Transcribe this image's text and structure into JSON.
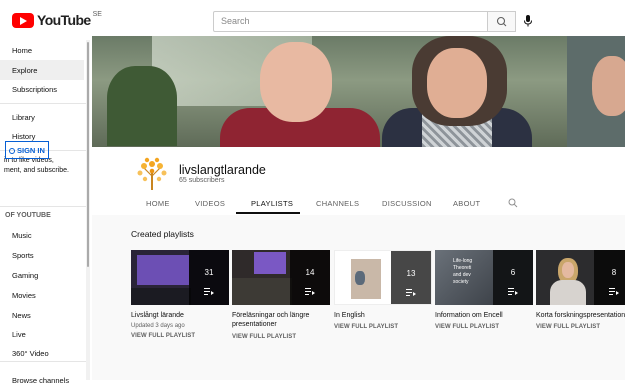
{
  "header": {
    "logo_text": "YouTube",
    "logo_country": "SE",
    "search_placeholder": "Search",
    "brand_color": "#ff0000"
  },
  "sidebar": {
    "items": [
      {
        "label": "Home"
      },
      {
        "label": "Explore",
        "active": true
      },
      {
        "label": "Subscriptions"
      },
      {
        "label": "Library"
      },
      {
        "label": "History"
      }
    ],
    "signin_prompt_line1": "in to like videos,",
    "signin_prompt_line2": "ment, and subscribe.",
    "signin_label": "SIGN IN",
    "section_heading": "OF YOUTUBE",
    "best_of": [
      {
        "label": "Music"
      },
      {
        "label": "Sports"
      },
      {
        "label": "Gaming"
      },
      {
        "label": "Movies"
      },
      {
        "label": "News"
      },
      {
        "label": "Live"
      },
      {
        "label": "360° Video"
      }
    ],
    "browse_channels": "Browse channels"
  },
  "channel": {
    "name": "livslangtlarande",
    "subscribers": "65 subscribers",
    "tabs": [
      {
        "label": "HOME"
      },
      {
        "label": "VIDEOS"
      },
      {
        "label": "PLAYLISTS",
        "active": true
      },
      {
        "label": "CHANNELS"
      },
      {
        "label": "DISCUSSION"
      },
      {
        "label": "ABOUT"
      }
    ]
  },
  "playlists_section": {
    "heading": "Created playlists",
    "items": [
      {
        "title": "Livslångt lärande",
        "count": "31",
        "meta": "Updated 3 days ago",
        "link": "VIEW FULL PLAYLIST"
      },
      {
        "title_line1": "Föreläsningar och längre",
        "title_line2": "presentationer",
        "count": "14",
        "link": "VIEW FULL PLAYLIST"
      },
      {
        "title": "In English",
        "count": "13",
        "link": "VIEW FULL PLAYLIST"
      },
      {
        "title": "Information om Encell",
        "count": "6",
        "link": "VIEW FULL PLAYLIST",
        "thumb_text_1": "Life-long",
        "thumb_text_2": "Theoreti",
        "thumb_text_3": "and dev",
        "thumb_text_4": "society"
      },
      {
        "title": "Korta forskningspresentation",
        "count": "8",
        "link": "VIEW FULL PLAYLIST"
      }
    ]
  }
}
